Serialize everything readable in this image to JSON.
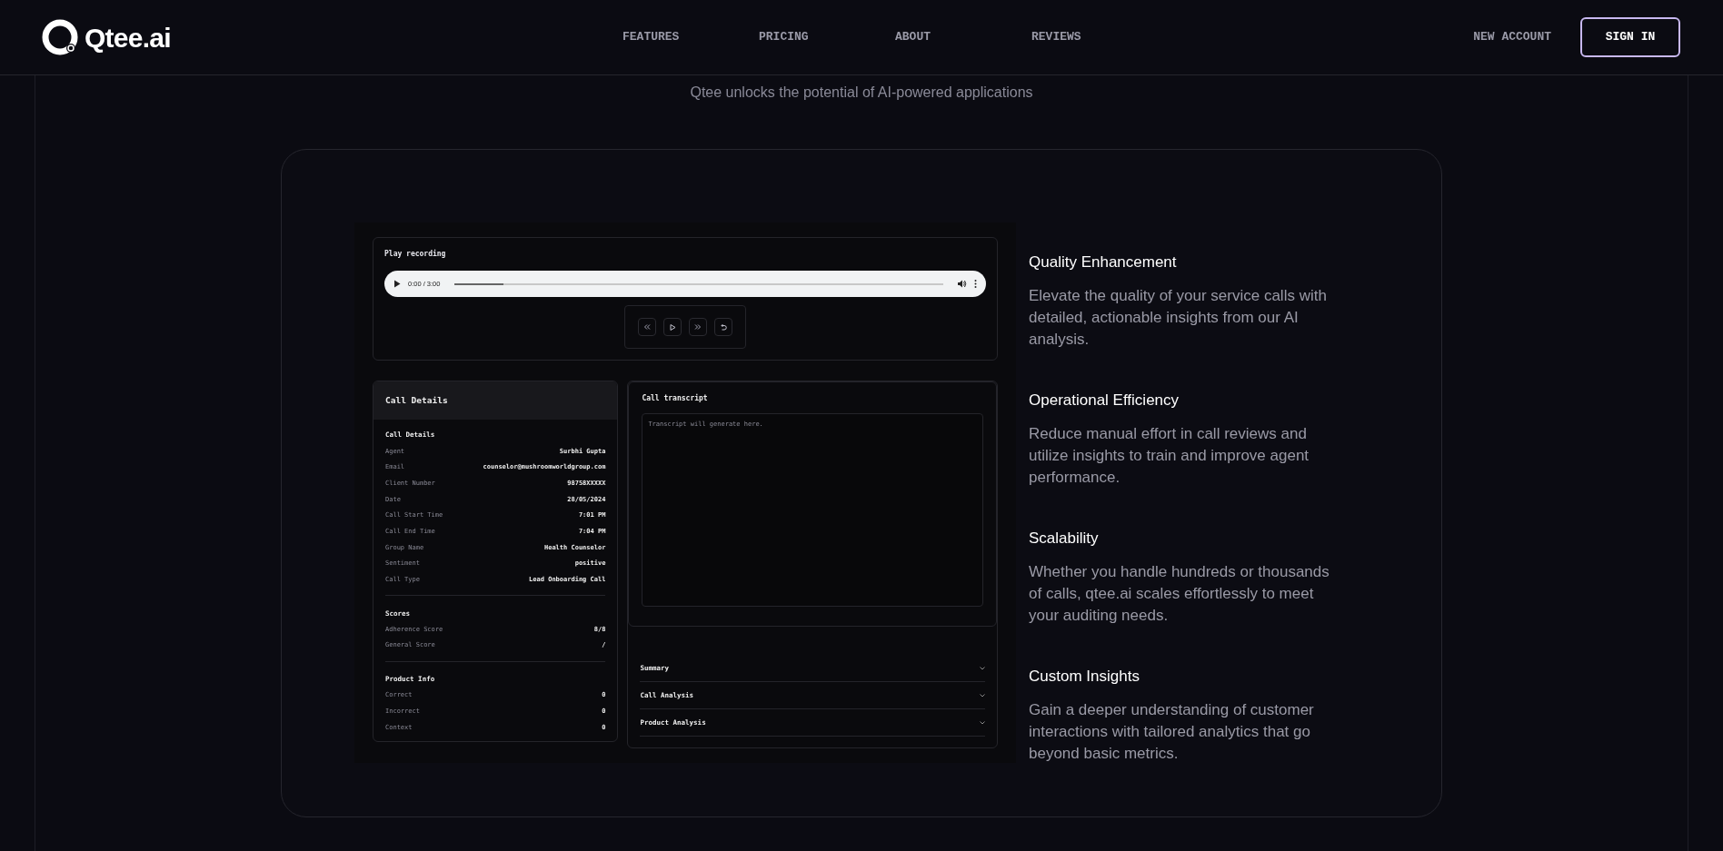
{
  "header": {
    "logo": "Qtee.ai",
    "nav": [
      "FEATURES",
      "PRICING",
      "ABOUT",
      "REVIEWS"
    ],
    "new_account": "NEW ACCOUNT",
    "sign_in": "SIGN IN"
  },
  "section": {
    "subtitle": "Qtee unlocks the potential of AI-powered applications"
  },
  "player": {
    "title": "Play recording",
    "time": "0:00 / 3:00",
    "level": 0.1
  },
  "call_details": {
    "header": "Call Details",
    "groups": [
      {
        "title": "Call Details",
        "rows": [
          {
            "label": "Agent",
            "value": "Surbhi Gupta"
          },
          {
            "label": "Email",
            "value": "counselor@mushroomworldgroup.com"
          },
          {
            "label": "Client Number",
            "value": "98758XXXXX"
          },
          {
            "label": "Date",
            "value": "28/05/2024"
          },
          {
            "label": "Call Start Time",
            "value": "7:01 PM"
          },
          {
            "label": "Call End Time",
            "value": "7:04 PM"
          },
          {
            "label": "Group Name",
            "value": "Health Counselor"
          },
          {
            "label": "Sentiment",
            "value": "positive"
          },
          {
            "label": "Call Type",
            "value": "Lead Onboarding Call"
          }
        ]
      },
      {
        "title": "Scores",
        "rows": [
          {
            "label": "Adherence Score",
            "value": "8/8"
          },
          {
            "label": "General Score",
            "value": "/"
          }
        ]
      },
      {
        "title": "Product Info",
        "rows": [
          {
            "label": "Correct",
            "value": "0"
          },
          {
            "label": "Incorrect",
            "value": "0"
          },
          {
            "label": "Context",
            "value": "0"
          }
        ]
      }
    ]
  },
  "transcript": {
    "title": "Call transcript",
    "placeholder": "Transcript will generate here."
  },
  "accordion": [
    {
      "label": "Summary",
      "expanded": false
    },
    {
      "label": "Call Analysis",
      "expanded": false
    },
    {
      "label": "Product Analysis",
      "expanded": false
    }
  ],
  "benefits": [
    {
      "title": "Quality Enhancement",
      "text": "Elevate the quality of your service calls with detailed, actionable insights from our AI analysis."
    },
    {
      "title": "Operational Efficiency",
      "text": "Reduce manual effort in call reviews and utilize insights to train and improve agent performance."
    },
    {
      "title": "Scalability",
      "text": "Whether you handle hundreds or thousands of calls, qtee.ai scales effortlessly to meet your auditing needs."
    },
    {
      "title": "Custom Insights",
      "text": "Gain a deeper understanding of customer interactions with tailored analytics that go beyond basic metrics."
    }
  ]
}
